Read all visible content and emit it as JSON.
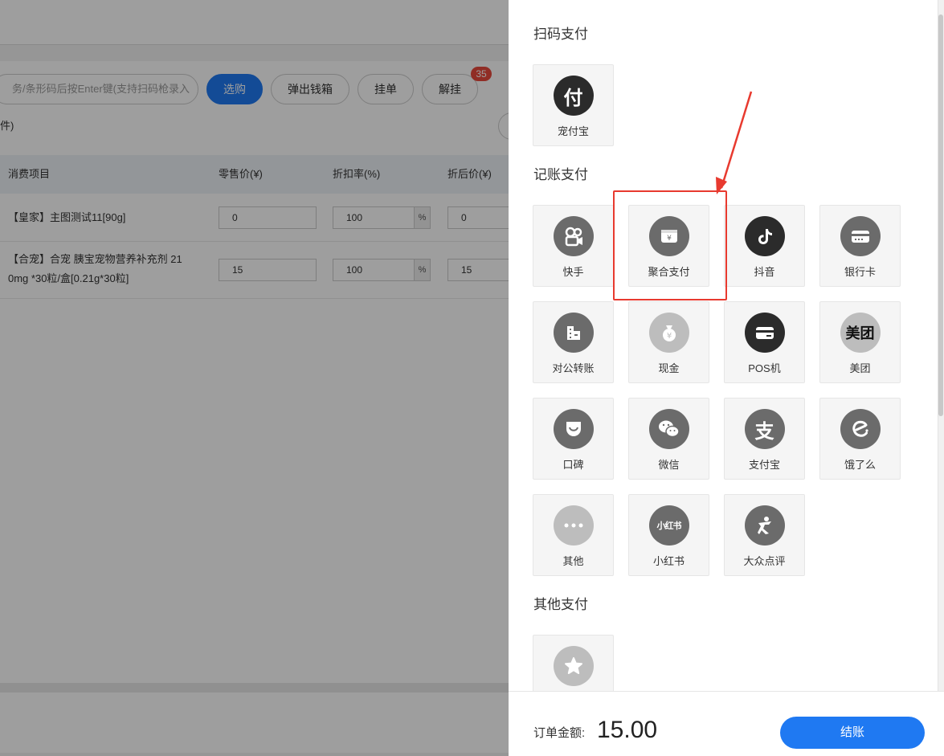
{
  "background": {
    "scan_placeholder": "务/条形码后按Enter键(支持扫码枪录入",
    "toolbar": {
      "select_label": "选购",
      "cash_drawer_label": "弹出钱箱",
      "hold_label": "挂单",
      "unhold_label": "解挂",
      "unhold_badge": "35"
    },
    "count_text": "件)",
    "table": {
      "headers": [
        "消费项目",
        "零售价(¥)",
        "折扣率(%)",
        "折后价(¥)"
      ],
      "rows": [
        {
          "name": "【皇家】主图测试11[90g]",
          "price": "0",
          "discount": "100",
          "discount_suffix": "%",
          "final": "0"
        },
        {
          "name_line1": "【合宠】合宠 胰宝宠物营养补充剂 21",
          "name_line2": "0mg *30粒/盒[0.21g*30粒]",
          "price": "15",
          "discount": "100",
          "discount_suffix": "%",
          "final": "15"
        }
      ]
    }
  },
  "drawer": {
    "sections": {
      "scan": "扫码支付",
      "ledger": "记账支付",
      "other": "其他支付"
    },
    "scan_methods": [
      {
        "label": "宠付宝",
        "icon": "fu-char-icon",
        "glyph": "付"
      }
    ],
    "ledger_methods": [
      {
        "label": "快手",
        "icon": "kuaishou-icon"
      },
      {
        "label": "聚合支付",
        "icon": "aggregate-pay-icon"
      },
      {
        "label": "抖音",
        "icon": "douyin-icon"
      },
      {
        "label": "银行卡",
        "icon": "bank-card-icon"
      },
      {
        "label": "对公转账",
        "icon": "corporate-transfer-icon"
      },
      {
        "label": "现金",
        "icon": "cash-icon"
      },
      {
        "label": "POS机",
        "icon": "pos-icon"
      },
      {
        "label": "美团",
        "icon": "meituan-icon",
        "glyph": "美团"
      },
      {
        "label": "口碑",
        "icon": "koubei-icon"
      },
      {
        "label": "微信",
        "icon": "wechat-icon"
      },
      {
        "label": "支付宝",
        "icon": "alipay-icon",
        "glyph": "支"
      },
      {
        "label": "饿了么",
        "icon": "eleme-icon"
      },
      {
        "label": "其他",
        "icon": "more-icon"
      },
      {
        "label": "小红书",
        "icon": "xiaohongshu-icon",
        "glyph": "小红书"
      },
      {
        "label": "大众点评",
        "icon": "dianping-icon"
      }
    ],
    "other_methods": [
      {
        "label": "",
        "icon": "star-icon"
      }
    ],
    "footer": {
      "amount_label": "订单金额:",
      "amount_value": "15.00",
      "checkout_label": "结账"
    }
  },
  "colors": {
    "primary": "#1f79f2",
    "highlight": "#e83a2f",
    "badge": "#e84a3c"
  }
}
